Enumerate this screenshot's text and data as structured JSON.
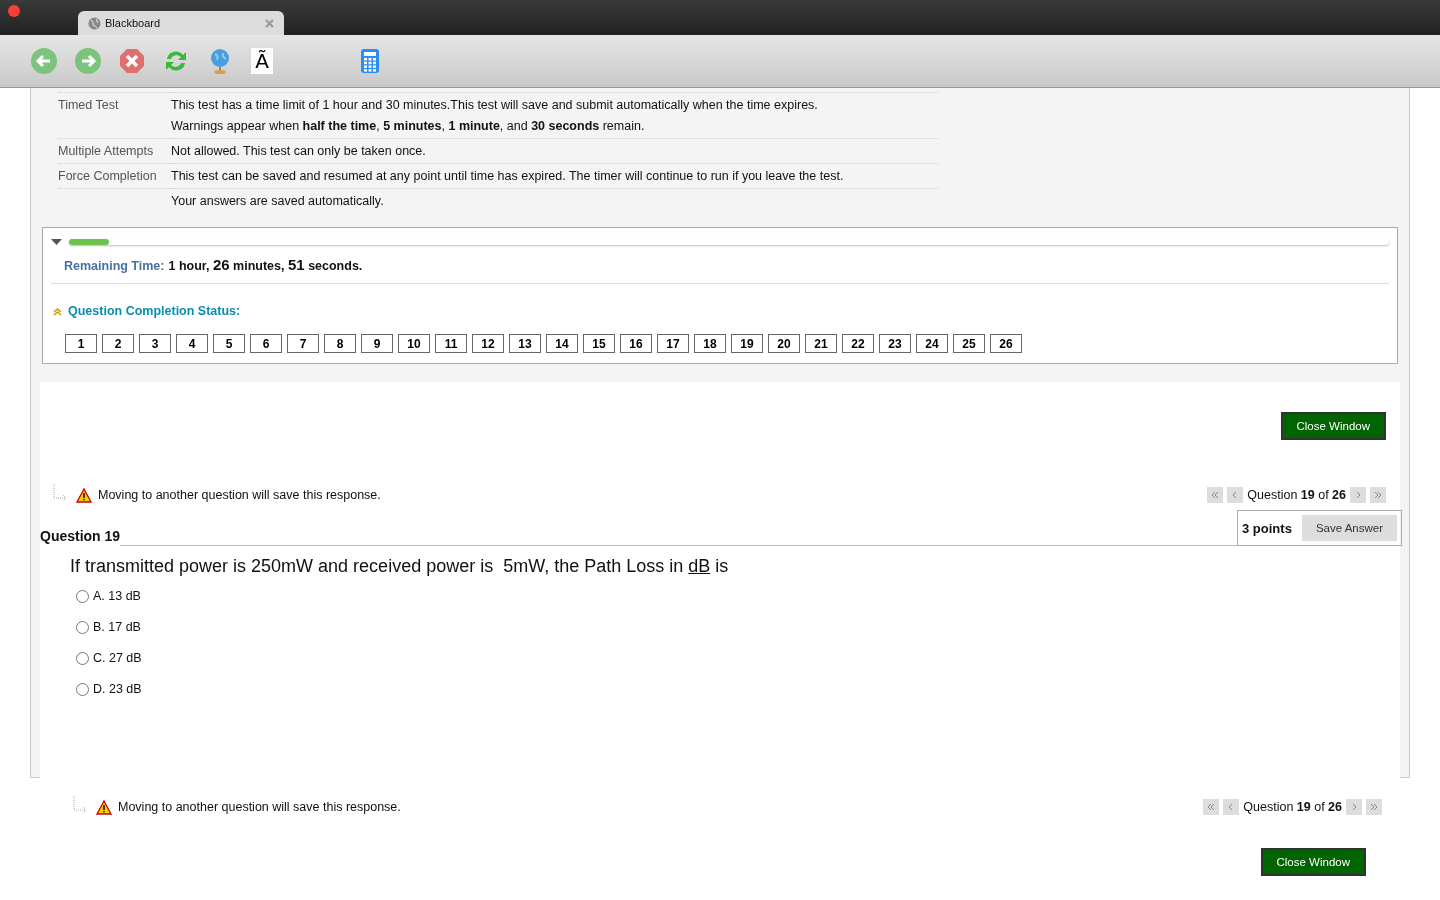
{
  "window": {
    "tab_title": "Blackboard",
    "toolbar": {
      "font_button": "Ã"
    }
  },
  "test_info": [
    {
      "label": "Timed Test",
      "value": "This test has a time limit of 1 hour and 30 minutes.This test will save and submit automatically when the time expires.",
      "extra": "Warnings appear when **half the time**, **5 minutes**, **1 minute**, and **30 seconds** remain."
    },
    {
      "label": "Multiple Attempts",
      "value": "Not allowed. This test can only be taken once."
    },
    {
      "label": "Force Completion",
      "value": "This test can be saved and resumed at any point until time has expired. The timer will continue to run if you leave the test.",
      "extra": "Your answers are saved automatically."
    }
  ],
  "timer": {
    "expanded": true,
    "level": 0.03,
    "label": "Remaining Time:",
    "value": [
      {
        "text": "1 hour, ",
        "big": false
      },
      {
        "text": "26",
        "big": true
      },
      {
        "text": " minutes, ",
        "big": false
      },
      {
        "text": "51",
        "big": true
      },
      {
        "text": " seconds.",
        "big": false
      }
    ]
  },
  "completion": {
    "title": "Question Completion Status:",
    "expanded": true,
    "questions": [
      "1",
      "2",
      "3",
      "4",
      "5",
      "6",
      "7",
      "8",
      "9",
      "10",
      "11",
      "12",
      "13",
      "14",
      "15",
      "16",
      "17",
      "18",
      "19",
      "20",
      "21",
      "22",
      "23",
      "24",
      "25",
      "26"
    ]
  },
  "close_button_top": "Close Window",
  "nav_top": {
    "warning": "Moving to another question will save this response.",
    "position": "Question **19** of **26**"
  },
  "question": {
    "title": "Question 19",
    "points": "3 points",
    "save_button": "Save Answer",
    "text": [
      {
        "text": "If transmitted power is 250mW and received power is  5mW, the Path Loss in ",
        "underline": false
      },
      {
        "text": "dB",
        "underline": true
      },
      {
        "text": " is",
        "underline": false
      }
    ],
    "options": [
      {
        "label": "A. 13 dB",
        "selected": false
      },
      {
        "label": "B. 17 dB",
        "selected": false
      },
      {
        "label": "C. 27 dB",
        "selected": false
      },
      {
        "label": "D. 23 dB",
        "selected": false
      }
    ]
  },
  "nav_bottom": {
    "warning": "Moving to another question will save this response.",
    "position": "Question **19** of **26**"
  },
  "close_button_bottom": "Close Window"
}
